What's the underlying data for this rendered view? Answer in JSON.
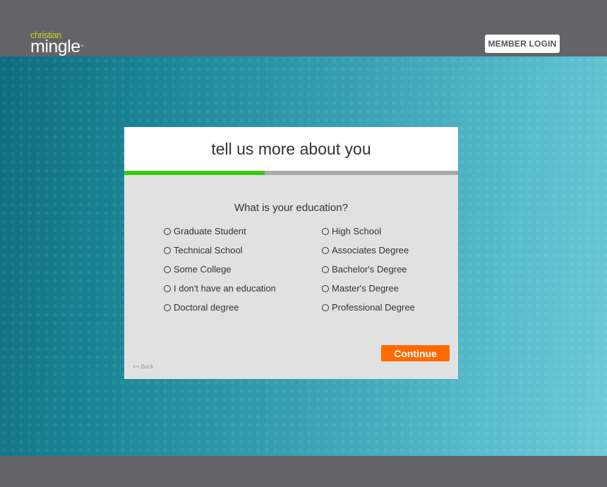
{
  "brand": {
    "logo_top": "christian",
    "logo_bottom": "mingle",
    "trademark": "™"
  },
  "header": {
    "login_label": "MEMBER LOGIN"
  },
  "card": {
    "title": "tell us more about you",
    "progress": 0.42,
    "question": "What is your education?",
    "options_left": [
      "Graduate Student",
      "Technical School",
      "Some College",
      "I don't have an education",
      "Doctoral degree"
    ],
    "options_right": [
      "High School",
      "Associates Degree",
      "Bachelor's Degree",
      "Master's Degree",
      "Professional Degree"
    ],
    "continue_label": "Continue",
    "back_label": "<< Back"
  },
  "colors": {
    "accent": "#ff6a00",
    "progress": "#33cc11",
    "logo_green": "#c8d51e"
  }
}
